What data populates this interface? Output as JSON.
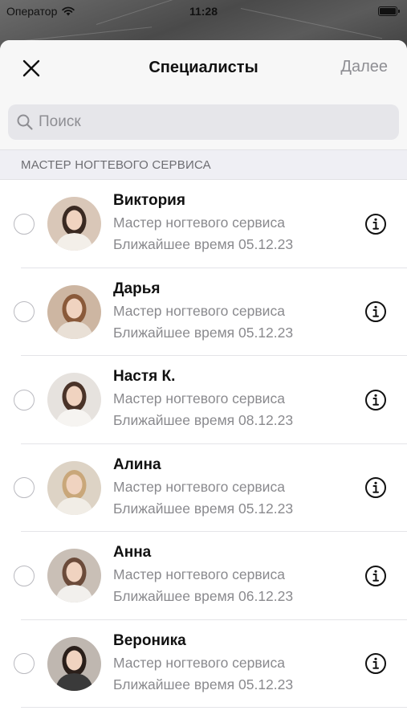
{
  "status_bar": {
    "carrier": "Оператор",
    "time": "11:28"
  },
  "nav": {
    "title": "Специалисты",
    "next_label": "Далее",
    "close_icon": "close-icon"
  },
  "search": {
    "placeholder": "Поиск",
    "value": ""
  },
  "section": {
    "header": "МАСТЕР НОГТЕВОГО СЕРВИСА"
  },
  "specialists": [
    {
      "name": "Виктория",
      "role": "Мастер ногтевого сервиса",
      "nearest": "Ближайшее время 05.12.23",
      "avatar_bg": "#d9c7b8",
      "hair": "#3a2a22",
      "top": "#f3efe9"
    },
    {
      "name": "Дарья",
      "role": "Мастер ногтевого сервиса",
      "nearest": "Ближайшее время 05.12.23",
      "avatar_bg": "#cdb6a2",
      "hair": "#8a5a3a",
      "top": "#e9e0d6"
    },
    {
      "name": "Настя К.",
      "role": "Мастер ногтевого сервиса",
      "nearest": "Ближайшее время 08.12.23",
      "avatar_bg": "#e6e2de",
      "hair": "#4a3328",
      "top": "#f6f4f1"
    },
    {
      "name": "Алина",
      "role": "Мастер ногтевого сервиса",
      "nearest": "Ближайшее время 05.12.23",
      "avatar_bg": "#ddd3c5",
      "hair": "#c9a77a",
      "top": "#f1ede6"
    },
    {
      "name": "Анна",
      "role": "Мастер ногтевого сервиса",
      "nearest": "Ближайшее время 06.12.23",
      "avatar_bg": "#c9bfb6",
      "hair": "#6b4b3a",
      "top": "#f2f0ed"
    },
    {
      "name": "Вероника",
      "role": "Мастер ногтевого сервиса",
      "nearest": "Ближайшее время 05.12.23",
      "avatar_bg": "#bfb7b0",
      "hair": "#2a1f1a",
      "top": "#3a3a3a"
    }
  ],
  "colors": {
    "accent_gray": "#8e8e93",
    "section_bg": "#efeff4"
  }
}
